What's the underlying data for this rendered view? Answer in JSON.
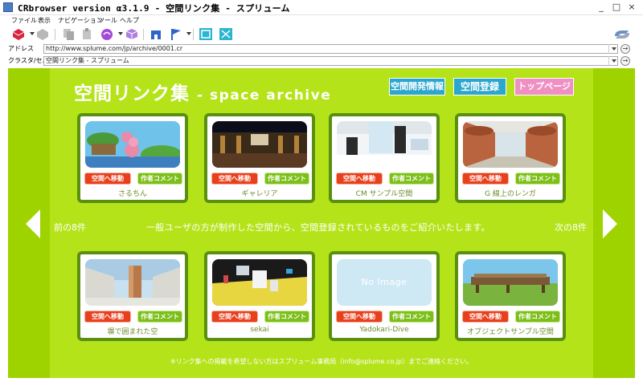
{
  "window": {
    "title": "CRbrowser version α3.1.9 - 空間リンク集 - スプリューム",
    "minimize": "_",
    "maximize": "□",
    "close": "×"
  },
  "menu": [
    "ファイル",
    "表示",
    "ナビゲーション",
    "ツール",
    "ヘルプ"
  ],
  "address_bar": {
    "label": "アドレス",
    "value": "http://www.splume.com/jp/archive/0001.cr"
  },
  "cluster_bar": {
    "label": "クラスタ/セル",
    "value": "空間リンク集 - スプリューム"
  },
  "go_glyph": "→",
  "page": {
    "title_main": "空間リンク集",
    "title_sub": "- space archive",
    "buttons": {
      "dev_info": "空間開発情報",
      "register": "空間登録",
      "top_page": "トップページ"
    },
    "prev": "前の8件",
    "next": "次の8件",
    "message": "一般ユーザの方が制作した空間から、空間登録されているものをご紹介いたします。",
    "footer": "※リンク集への掲載を希望しない方はスプリューム事務局（info@splume.co.jp）までご連絡ください。",
    "card_buttons": {
      "go": "空間へ移動",
      "comment": "作者コメント"
    },
    "no_image_text": "No Image"
  },
  "cards": [
    {
      "name": "さるちん",
      "thumb": "sky-island"
    },
    {
      "name": "ギャレリア",
      "thumb": "night-gallery"
    },
    {
      "name": "CM サンプル空間",
      "thumb": "cm-room"
    },
    {
      "name": "G 線上のレンガ",
      "thumb": "brick-corridor"
    },
    {
      "name": "塀で囲まれた空",
      "thumb": "walled-sky"
    },
    {
      "name": "sekai",
      "thumb": "sekai-scene"
    },
    {
      "name": "Yadokari-Dive",
      "thumb": "no-image"
    },
    {
      "name": "オブジェクトサンプル空間",
      "thumb": "object-sample"
    }
  ],
  "colors": {
    "page_bg": "#b5e31a",
    "outer_bg": "#9ed300",
    "card_border": "#5a8f12",
    "go_button": "#e8401d",
    "comment_button": "#7dbf1a",
    "blue_button": "#2aa6cf",
    "pink_button": "#f08fc2"
  }
}
